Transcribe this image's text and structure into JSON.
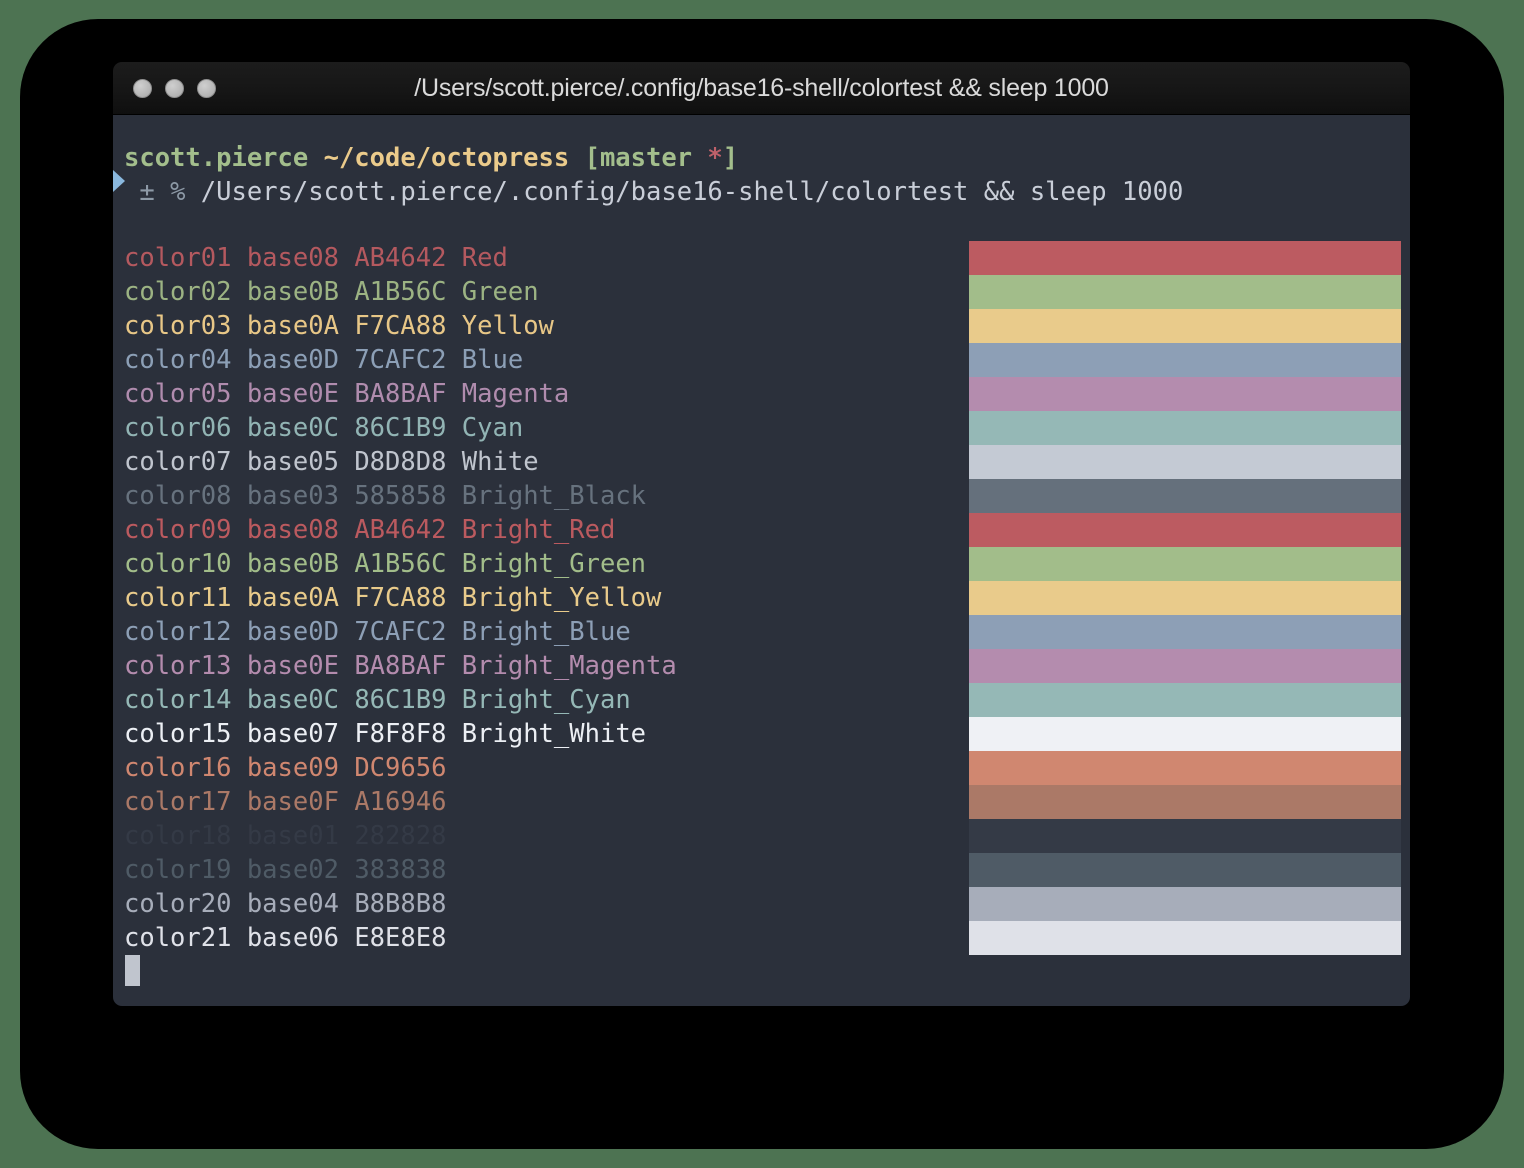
{
  "window": {
    "title": "/Users/scott.pierce/.config/base16-shell/colortest && sleep 1000",
    "traffic_lights": [
      "close",
      "minimize",
      "maximize"
    ]
  },
  "terminal": {
    "background": "#2b303b",
    "foreground": "#c0c5ce",
    "prompt": {
      "user": "scott.pierce",
      "path": "~/code/octopress",
      "branch_open": "[master",
      "dirty_marker": "*",
      "branch_close": "]",
      "user_color": "#a3be8c",
      "path_color": "#ebcb8b",
      "branch_color": "#a3be8c",
      "dirty_color": "#bf616a"
    },
    "command_line": {
      "vcs_symbol": "±",
      "prompt_char": "%",
      "command": "/Users/scott.pierce/.config/base16-shell/colortest && sleep 1000"
    },
    "cursor": {
      "shape": "block",
      "color": "#c0c5ce"
    },
    "rows": [
      {
        "name": "color01",
        "base": "base08",
        "hex": "AB4642",
        "label": "Red",
        "text_color": "#b4595f",
        "swatch": "#bc5b61"
      },
      {
        "name": "color02",
        "base": "base0B",
        "hex": "A1B56C",
        "label": "Green",
        "text_color": "#9cb383",
        "swatch": "#a2bd8a"
      },
      {
        "name": "color03",
        "base": "base0A",
        "hex": "F7CA88",
        "label": "Yellow",
        "text_color": "#e8c787",
        "swatch": "#e9cb8b"
      },
      {
        "name": "color04",
        "base": "base0D",
        "hex": "7CAFC2",
        "label": "Blue",
        "text_color": "#8c9fb6",
        "swatch": "#8d9fb6"
      },
      {
        "name": "color05",
        "base": "base0E",
        "hex": "BA8BAF",
        "label": "Magenta",
        "text_color": "#b08cae",
        "swatch": "#b48cae"
      },
      {
        "name": "color06",
        "base": "base0C",
        "hex": "86C1B9",
        "label": "Cyan",
        "text_color": "#92b4b4",
        "swatch": "#95b8b6"
      },
      {
        "name": "color07",
        "base": "base05",
        "hex": "D8D8D8",
        "label": "White",
        "text_color": "#c0c5ce",
        "swatch": "#c4cad4"
      },
      {
        "name": "color08",
        "base": "base03",
        "hex": "585858",
        "label": "Bright_Black",
        "text_color": "#67727e",
        "swatch": "#65707c"
      },
      {
        "name": "color09",
        "base": "base08",
        "hex": "AB4642",
        "label": "Bright_Red",
        "text_color": "#bb5a5f",
        "swatch": "#bc5b61"
      },
      {
        "name": "color10",
        "base": "base0B",
        "hex": "A1B56C",
        "label": "Bright_Green",
        "text_color": "#a2bd8a",
        "swatch": "#a2bd8a"
      },
      {
        "name": "color11",
        "base": "base0A",
        "hex": "F7CA88",
        "label": "Bright_Yellow",
        "text_color": "#e9cb8b",
        "swatch": "#e9cb8b"
      },
      {
        "name": "color12",
        "base": "base0D",
        "hex": "7CAFC2",
        "label": "Bright_Blue",
        "text_color": "#8d9fb6",
        "swatch": "#8d9fb6"
      },
      {
        "name": "color13",
        "base": "base0E",
        "hex": "BA8BAF",
        "label": "Bright_Magenta",
        "text_color": "#b48cae",
        "swatch": "#b48cae"
      },
      {
        "name": "color14",
        "base": "base0C",
        "hex": "86C1B9",
        "label": "Bright_Cyan",
        "text_color": "#95b8b6",
        "swatch": "#95b8b6"
      },
      {
        "name": "color15",
        "base": "base07",
        "hex": "F8F8F8",
        "label": "Bright_White",
        "text_color": "#eceff4",
        "swatch": "#eff1f5"
      },
      {
        "name": "color16",
        "base": "base09",
        "hex": "DC9656",
        "label": "",
        "text_color": "#d08770",
        "swatch": "#d08770"
      },
      {
        "name": "color17",
        "base": "base0F",
        "hex": "A16946",
        "label": "",
        "text_color": "#ab7967",
        "swatch": "#ab7967"
      },
      {
        "name": "color18",
        "base": "base01",
        "hex": "282828",
        "label": "",
        "text_color": "#343a46",
        "swatch": "#343a46"
      },
      {
        "name": "color19",
        "base": "base02",
        "hex": "383838",
        "label": "",
        "text_color": "#4f5b66",
        "swatch": "#4f5b66"
      },
      {
        "name": "color20",
        "base": "base04",
        "hex": "B8B8B8",
        "label": "",
        "text_color": "#a7adba",
        "swatch": "#a7adba"
      },
      {
        "name": "color21",
        "base": "base06",
        "hex": "E8E8E8",
        "label": "",
        "text_color": "#dfe1e8",
        "swatch": "#dfe1e8"
      }
    ]
  },
  "desktop": {
    "wallpaper_color": "#4d7352",
    "backdrop_color": "#000000"
  }
}
